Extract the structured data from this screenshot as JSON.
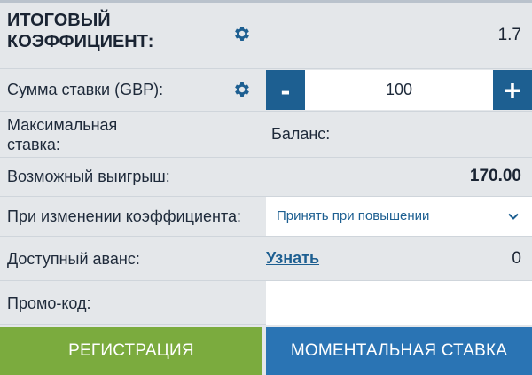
{
  "odds": {
    "label_line1": "ИТОГОВЫЙ",
    "label_line2": "КОЭФФИЦИЕНТ:",
    "value": "1.7",
    "icon": "gear-icon"
  },
  "stake": {
    "label": "Сумма ставки (GBP):",
    "icon": "gear-icon",
    "minus": "-",
    "plus": "+",
    "value": "100"
  },
  "max_stake": {
    "label_line1": "Максимальная",
    "label_line2": "ставка:"
  },
  "balance": {
    "label": "Баланс:"
  },
  "possible_win": {
    "label": "Возможный выигрыш:",
    "value": "170.00"
  },
  "odds_change": {
    "label": "При изменении коэффициента:",
    "selected": "Принять при повышении",
    "icon": "chevron-down-icon"
  },
  "advance": {
    "label": "Доступный аванс:",
    "link": "Узнать",
    "value": "0"
  },
  "promo": {
    "label": "Промо-код:",
    "value": ""
  },
  "buttons": {
    "register": "РЕГИСТРАЦИЯ",
    "instant_bet": "МОМЕНТАЛЬНАЯ СТАВКА"
  },
  "colors": {
    "background": "#e4e7ea",
    "accent_blue": "#1d5f91",
    "button_blue": "#2a74b4",
    "button_green": "#7bab3e"
  }
}
